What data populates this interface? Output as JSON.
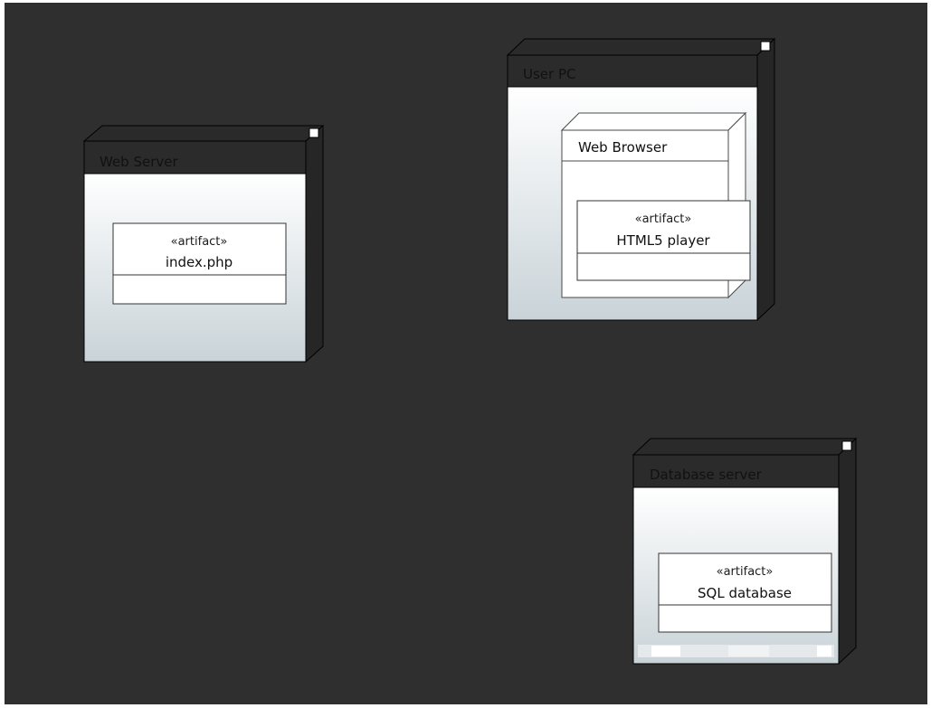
{
  "diagram": {
    "colors": {
      "background": "#2f2f2f",
      "node_edge": "#000000",
      "node_side": "#2a2a2a",
      "node_title_bar": "#2b2b2b",
      "node_body_top": "#ffffff",
      "node_body_bottom": "#c9d3d8",
      "artifact_fill": "#ffffff",
      "artifact_stroke": "#333333"
    },
    "nodes": [
      {
        "id": "web-server",
        "title": "Web Server",
        "artifacts": [
          {
            "stereotype": "«artifact»",
            "name": "index.php"
          }
        ]
      },
      {
        "id": "user-pc",
        "title": "User PC",
        "children": [
          {
            "id": "web-browser",
            "title": "Web Browser",
            "artifacts": [
              {
                "stereotype": "«artifact»",
                "name": "HTML5 player"
              }
            ]
          }
        ]
      },
      {
        "id": "database-server",
        "title": "Database server",
        "artifacts": [
          {
            "stereotype": "«artifact»",
            "name": "SQL database"
          }
        ]
      }
    ]
  }
}
